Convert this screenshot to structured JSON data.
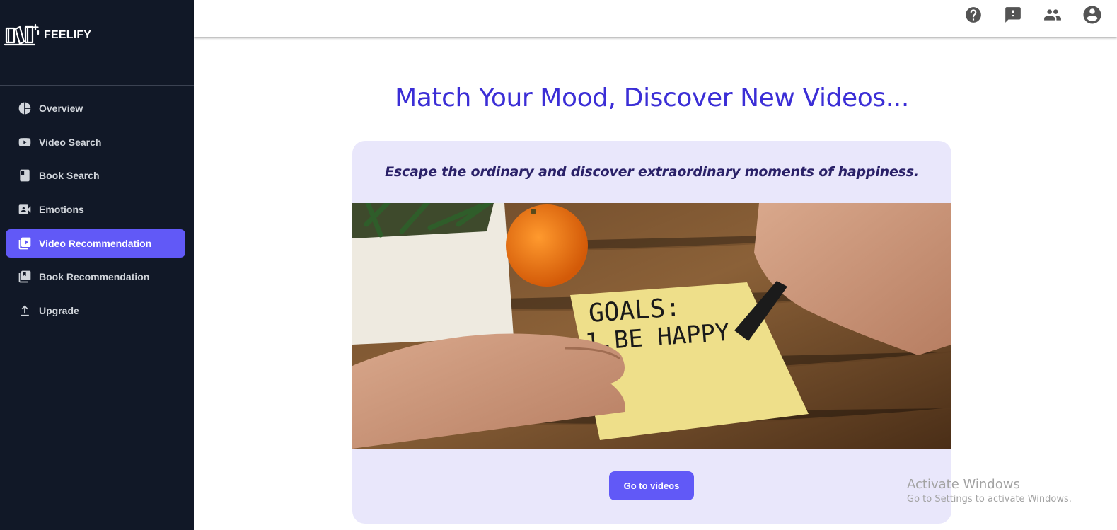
{
  "app": {
    "name": "FEELIFY"
  },
  "sidebar": {
    "items": [
      {
        "label": "Overview",
        "icon": "pie-chart-icon",
        "active": false
      },
      {
        "label": "Video Search",
        "icon": "youtube-icon",
        "active": false
      },
      {
        "label": "Book Search",
        "icon": "book-icon",
        "active": false
      },
      {
        "label": "Emotions",
        "icon": "video-camera-icon",
        "active": false
      },
      {
        "label": "Video Recommendation",
        "icon": "video-library-icon",
        "active": true
      },
      {
        "label": "Book Recommendation",
        "icon": "book-library-icon",
        "active": false
      },
      {
        "label": "Upgrade",
        "icon": "arrow-up-icon",
        "active": false
      }
    ]
  },
  "topbar": {
    "icons": [
      "help-icon",
      "feedback-icon",
      "people-icon",
      "account-circle-icon"
    ]
  },
  "main": {
    "title": "Match Your Mood, Discover New Videos...",
    "tagline": "Escape the ordinary and discover extraordinary moments of happiness.",
    "image_note_text": "GOALS:\n1.BE HAPPY",
    "cta_label": "Go to videos"
  },
  "watermark": {
    "title": "Activate Windows",
    "subtitle": "Go to Settings to activate Windows."
  },
  "colors": {
    "sidebar_bg": "#111827",
    "accent": "#6159f7",
    "title": "#3b2ed6",
    "card_bg": "#e9e7fb"
  }
}
